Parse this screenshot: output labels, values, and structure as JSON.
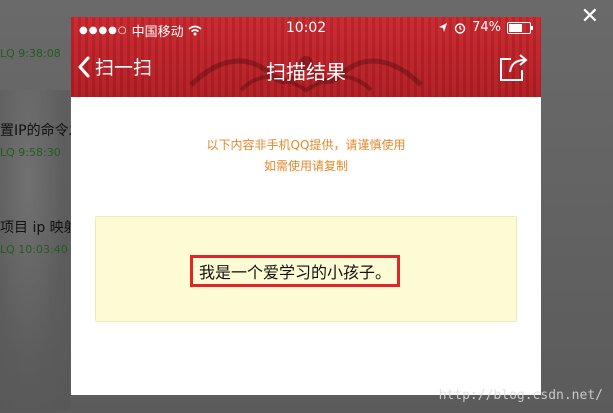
{
  "background_chat": {
    "lines": [
      {
        "kind": "meta",
        "text": "LQ  9:38:08"
      },
      {
        "kind": "msg",
        "text": "置IP的命令发"
      },
      {
        "kind": "meta",
        "text": "LQ  9:58:30"
      },
      {
        "kind": "msg",
        "text": "项目  ip 映射"
      },
      {
        "kind": "meta",
        "text": "LQ  10:03:40"
      }
    ]
  },
  "status_bar": {
    "carrier": "中国移动",
    "time": "10:02",
    "battery_percent": "74%",
    "battery_level": 0.74
  },
  "nav": {
    "back_label": "扫一扫",
    "title": "扫描结果"
  },
  "notice": {
    "line1": "以下内容非手机QQ提供，请谨慎使用",
    "line2": "如需使用请复制"
  },
  "result": {
    "text": "我是一个爱学习的小孩子。"
  },
  "watermark": "http://blog.csdn.net/",
  "colors": {
    "header_red": "#c8262c",
    "notice_orange": "#e4892a",
    "highlight_red": "#e0262b",
    "result_bg": "#fdfbd4"
  }
}
